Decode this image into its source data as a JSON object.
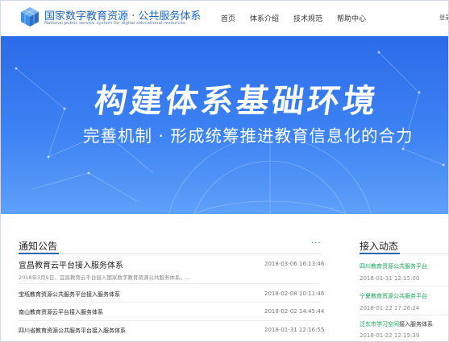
{
  "header": {
    "brand_cn": "国家数字教育资源 · 公共服务体系",
    "brand_en": "National public service system for digital educational resources",
    "nav": [
      "首页",
      "体系介绍",
      "技术规范",
      "帮助中心"
    ],
    "nav_cut": "登录",
    "logo_icon": "hex-cube-logo-icon"
  },
  "banner": {
    "title": "构建体系基础环境",
    "subtitle": "完善机制 · 形成统筹推进教育信息化的合力"
  },
  "notices": {
    "heading": "通知公告",
    "more": "···",
    "items": [
      {
        "title": "宜昌教育云平台接入服务体系",
        "date": "2018-03-06 16:13:46",
        "summary": "2018年3月6日，宜昌教育云平台接入国家数字教育资源公共服务体系。..."
      },
      {
        "title": "宝坻教育资源公共服务平台接入服务体系",
        "date": "2018-02-08 10:11:46"
      },
      {
        "title": "南山教育资源云平台接入服务体系",
        "date": "2018-02-02 14:45:44"
      },
      {
        "title": "四川省教育资源公共服务平台接入服务体系",
        "date": "2018-01-31 12:16:55"
      }
    ]
  },
  "access": {
    "heading": "接入动态",
    "items": [
      {
        "name": "四川教育资源公共服务平台",
        "date": "2018-01-31 12:15:00"
      },
      {
        "name": "宁夏教育资源公共服务平台",
        "date": "2018-01-22 17:26:24"
      },
      {
        "name": "泛东市学习空间",
        "date": "2018-01-22 12:15:39"
      }
    ],
    "suffix_second": "接入服务体系"
  },
  "colors": {
    "brand": "#1f65b6",
    "banner": "#3d83f4",
    "link_green": "#1aa35e"
  }
}
